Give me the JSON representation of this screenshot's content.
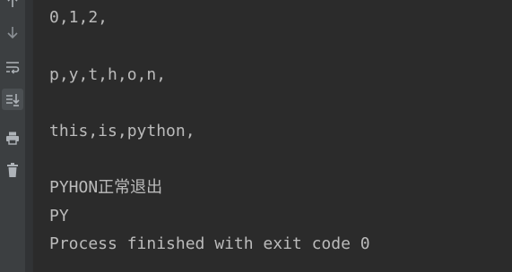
{
  "toolbar": {
    "buttons": [
      {
        "icon": "arrow-up-icon"
      },
      {
        "icon": "arrow-down-icon"
      },
      {
        "icon": "soft-wrap-icon"
      },
      {
        "icon": "scroll-to-end-icon",
        "active": true
      },
      {
        "icon": "print-icon"
      },
      {
        "icon": "trash-icon"
      }
    ]
  },
  "console": {
    "lines": [
      "0,1,2,",
      "p,y,t,h,o,n,",
      "this,is,python,",
      "PYHON正常退出",
      "PY",
      "Process finished with exit code 0"
    ]
  },
  "colors": {
    "background": "#2b2b2b",
    "toolbar": "#3c3f41",
    "text": "#bbbbbb",
    "icon": "#aeb3b8"
  }
}
